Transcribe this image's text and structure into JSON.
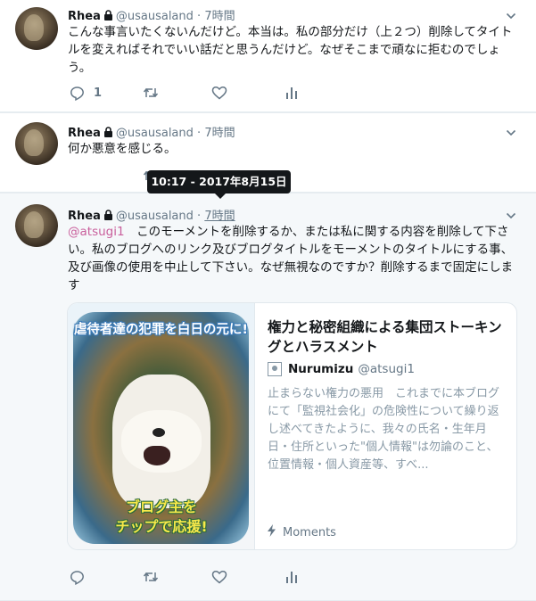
{
  "tweets": [
    {
      "name": "Rhea",
      "handle": "@usausaland",
      "sep": "·",
      "time": "7時間",
      "text": "こんな事言いたくないんだけど。本当は。私の部分だけ（上２つ）削除してタイトルを変えればそれでいい話だと思うんだけど。なぜそこまで頑なに拒むのでしょう。",
      "reply_count": "1"
    },
    {
      "name": "Rhea",
      "handle": "@usausaland",
      "sep": "·",
      "time": "7時間",
      "text": "何か悪意を感じる。"
    },
    {
      "name": "Rhea",
      "handle": "@usausaland",
      "sep": "·",
      "time": "7時間",
      "mention": "@atsugi1",
      "text": "　このモーメントを削除するか、または私に関する内容を削除して下さい。私のブログへのリンク及びブログタイトルをモーメントのタイトルにする事、及び画像の使用を中止して下さい。なぜ無視なのですか？削除するまで固定にします"
    }
  ],
  "tooltip": "10:17 - 2017年8月15日",
  "card": {
    "image_banner_top": "虐待者達の犯罪を白日の元に!",
    "image_banner_bottom_1": "ブログ主を",
    "image_banner_bottom_2": "チップで応援!",
    "title": "権力と秘密組織による集団ストーキングとハラスメント",
    "author_name": "Nurumizu",
    "author_handle": "@atsugi1",
    "description": "止まらない権力の悪用　これまでに本ブログにて「監視社会化」の危険性について繰り返し述べてきたように、我々の氏名・生年月日・住所といった\"個人情報\"は勿論のこと、位置情報・個人資産等、すべ...",
    "source": "Moments"
  },
  "icons": {
    "reply": "reply-icon",
    "retweet": "retweet-icon",
    "like": "heart-icon",
    "analytics": "analytics-icon",
    "lock": "lock-icon",
    "caret": "chevron-down-icon",
    "moments": "lightning-icon"
  },
  "colors": {
    "mention": "#c95f9c",
    "muted": "#657786",
    "tooltip_bg": "#14171a"
  }
}
